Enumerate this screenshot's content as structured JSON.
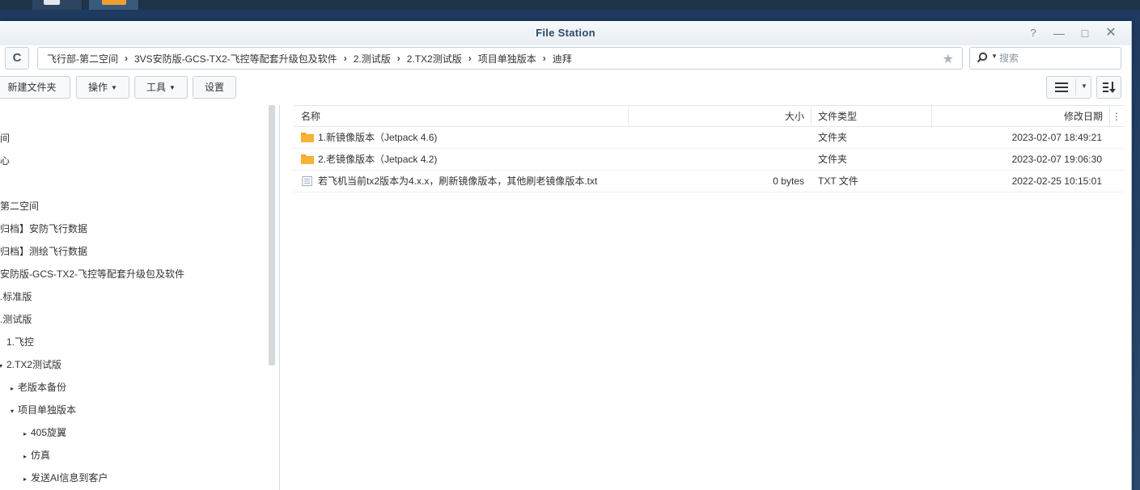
{
  "window": {
    "title": "File Station",
    "help_glyph": "?",
    "min_glyph": "—",
    "max_glyph": "□",
    "close_glyph": "✕"
  },
  "address": {
    "refresh_glyph": "C",
    "breadcrumbs": [
      "飞行部-第二空间",
      "3VS安防版-GCS-TX2-飞控等配套升级包及软件",
      "2.测试版",
      "2.TX2测试版",
      "项目单独版本",
      "迪拜"
    ],
    "separator": "›",
    "search_placeholder": "搜索",
    "favorite_icon": "star-icon"
  },
  "toolbar": {
    "new_folder": "新建文件夹",
    "action": "操作",
    "tools": "工具",
    "settings": "设置"
  },
  "tree": {
    "items": [
      {
        "label": "间",
        "arrow": ""
      },
      {
        "label": "心",
        "arrow": ""
      },
      {
        "label": "",
        "arrow": ""
      },
      {
        "label": "第二空间",
        "arrow": ""
      },
      {
        "label": "归档】安防飞行数据",
        "arrow": ""
      },
      {
        "label": "归档】测绘飞行数据",
        "arrow": ""
      },
      {
        "label": "安防版-GCS-TX2-飞控等配套升级包及软件",
        "arrow": ""
      },
      {
        "label": ".标准版",
        "arrow": ""
      },
      {
        "label": ".测试版",
        "arrow": ""
      },
      {
        "label": "1.飞控",
        "arrow": ""
      },
      {
        "label": "2.TX2测试版",
        "arrow": "▾"
      },
      {
        "label": "老版本备份",
        "arrow": "▸"
      },
      {
        "label": "项目单独版本",
        "arrow": "▾"
      },
      {
        "label": "405旋翼",
        "arrow": "▸"
      },
      {
        "label": "仿真",
        "arrow": "▸"
      },
      {
        "label": "发送AI信息到客户",
        "arrow": "▸"
      }
    ]
  },
  "filelist": {
    "headers": {
      "name": "名称",
      "size": "大小",
      "type": "文件类型",
      "modified": "修改日期",
      "menu": "⋮"
    },
    "rows": [
      {
        "icon": "folder-icon",
        "name": "1.新镜像版本（Jetpack 4.6)",
        "size": "",
        "type": "文件夹",
        "modified": "2023-02-07 18:49:21"
      },
      {
        "icon": "folder-icon",
        "name": "2.老镜像版本（Jetpack 4.2)",
        "size": "",
        "type": "文件夹",
        "modified": "2023-02-07 19:06:30"
      },
      {
        "icon": "text-file-icon",
        "name": "若飞机当前tx2版本为4.x.x，刷新镜像版本，其他刷老镜像版本.txt",
        "size": "0 bytes",
        "type": "TXT 文件",
        "modified": "2022-02-25 10:15:01"
      }
    ]
  },
  "colors": {
    "title_text": "#2b4a6b",
    "folder": "#f5a623",
    "desktop": "#1e3a5f"
  }
}
